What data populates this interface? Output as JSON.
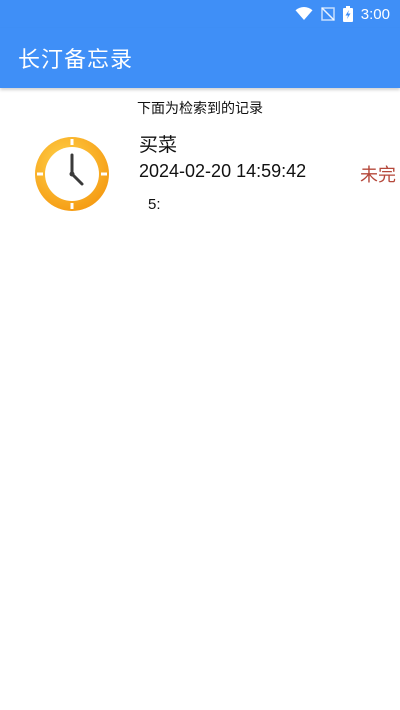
{
  "status_bar": {
    "time": "3:00",
    "icons": [
      "wifi-icon",
      "no-signal-icon",
      "battery-charging-icon"
    ]
  },
  "app_bar": {
    "title": "长汀备忘录",
    "background": "#3f8ff7"
  },
  "search_caption": "下面为检索到的记录",
  "records": [
    {
      "icon": "clock-icon",
      "title": "买菜",
      "datetime": "2024-02-20 14:59:42",
      "status": "未完",
      "content": "5:"
    }
  ],
  "colors": {
    "status_pending": "#b5483b",
    "clock_outer": "#f7a21b",
    "clock_face": "#ffffff"
  }
}
